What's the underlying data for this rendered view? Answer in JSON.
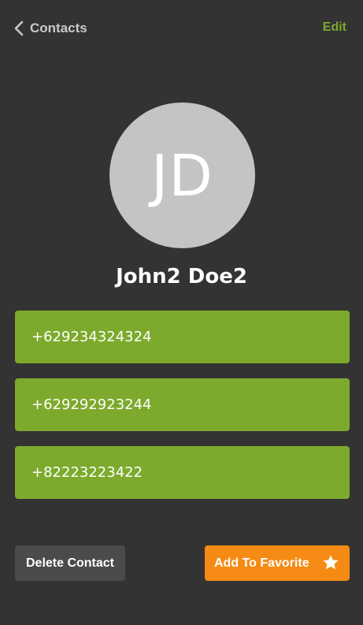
{
  "nav": {
    "back_label": "Contacts",
    "back_icon": "chevron-left-icon",
    "edit_label": "Edit"
  },
  "contact": {
    "initials": "JD",
    "name": "John2 Doe2",
    "phones": [
      "+629234324324",
      "+629292923244",
      "+82223223422"
    ]
  },
  "actions": {
    "delete_label": "Delete Contact",
    "favorite_label": "Add To Favorite",
    "favorite_icon": "star-icon"
  },
  "colors": {
    "background": "#333333",
    "accent_green": "#7daa2c",
    "favorite_orange": "#f58b14",
    "delete_gray": "#4b4a4c",
    "avatar_gray": "#c4c4c4"
  }
}
